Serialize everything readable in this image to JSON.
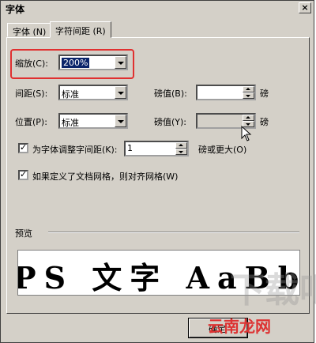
{
  "window": {
    "title": "字体",
    "close_glyph": "×"
  },
  "tabs": [
    {
      "label": "字体 (N)",
      "active": false
    },
    {
      "label": "字符间距 (R)",
      "active": true
    }
  ],
  "spacing": {
    "scale_label": "缩放(C):",
    "scale_value": "200%",
    "spacing_label": "间距(S):",
    "spacing_value": "标准",
    "spacing_pt_label": "磅值(B):",
    "spacing_pt_value": "",
    "spacing_pt_unit": "磅",
    "position_label": "位置(P):",
    "position_value": "标准",
    "position_pt_label": "磅值(Y):",
    "position_pt_value": "",
    "position_pt_unit": "磅"
  },
  "kerning": {
    "label": "为字体调整字间距(K):",
    "value": "1",
    "suffix": "磅或更大(O)",
    "checked": true
  },
  "grid": {
    "label": "如果定义了文档网格，则对齐网格(W)",
    "checked": true
  },
  "preview": {
    "label": "预览",
    "sample": "PS 文字 AaBb"
  },
  "buttons": {
    "ok_label": "确定"
  },
  "watermark": {
    "text": "云南龙网",
    "bg_text": "下载吧"
  },
  "colors": {
    "highlight": "#e03030",
    "selection": "#0a246a",
    "dialog_bg": "#d4d0c8"
  }
}
